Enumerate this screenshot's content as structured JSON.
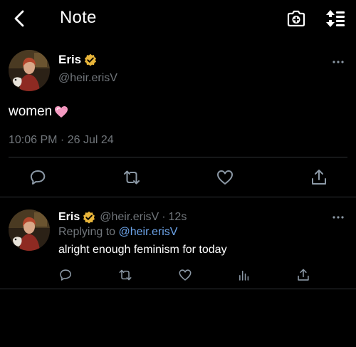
{
  "header": {
    "title": "Note",
    "back_icon": "chevron-left-icon",
    "camera_icon": "camera-plus-icon",
    "sort_icon": "sort-arrows-icon"
  },
  "tweet": {
    "name": "Eris",
    "handle": "@heir.erisV",
    "text": "women",
    "emoji": "pink-heart",
    "timestamp": "10:06 PM · 26 Jul 24",
    "actions": [
      "reply-icon",
      "retweet-icon",
      "like-icon",
      "share-icon"
    ]
  },
  "reply": {
    "name": "Eris",
    "handle": "@heir.erisV",
    "separator": "·",
    "time": "12s",
    "replying_prefix": "Replying to ",
    "replying_to": "@heir.erisV",
    "text": "alright enough feminism for today",
    "actions": [
      "reply-icon",
      "retweet-icon",
      "like-icon",
      "views-icon",
      "share-icon"
    ]
  },
  "colors": {
    "background": "#000000",
    "text": "#ffffff",
    "muted": "#71767b",
    "link": "#6ca3e8",
    "verified": "#e8b53a",
    "divider": "#2f3336",
    "heart": "#f49ac1"
  }
}
